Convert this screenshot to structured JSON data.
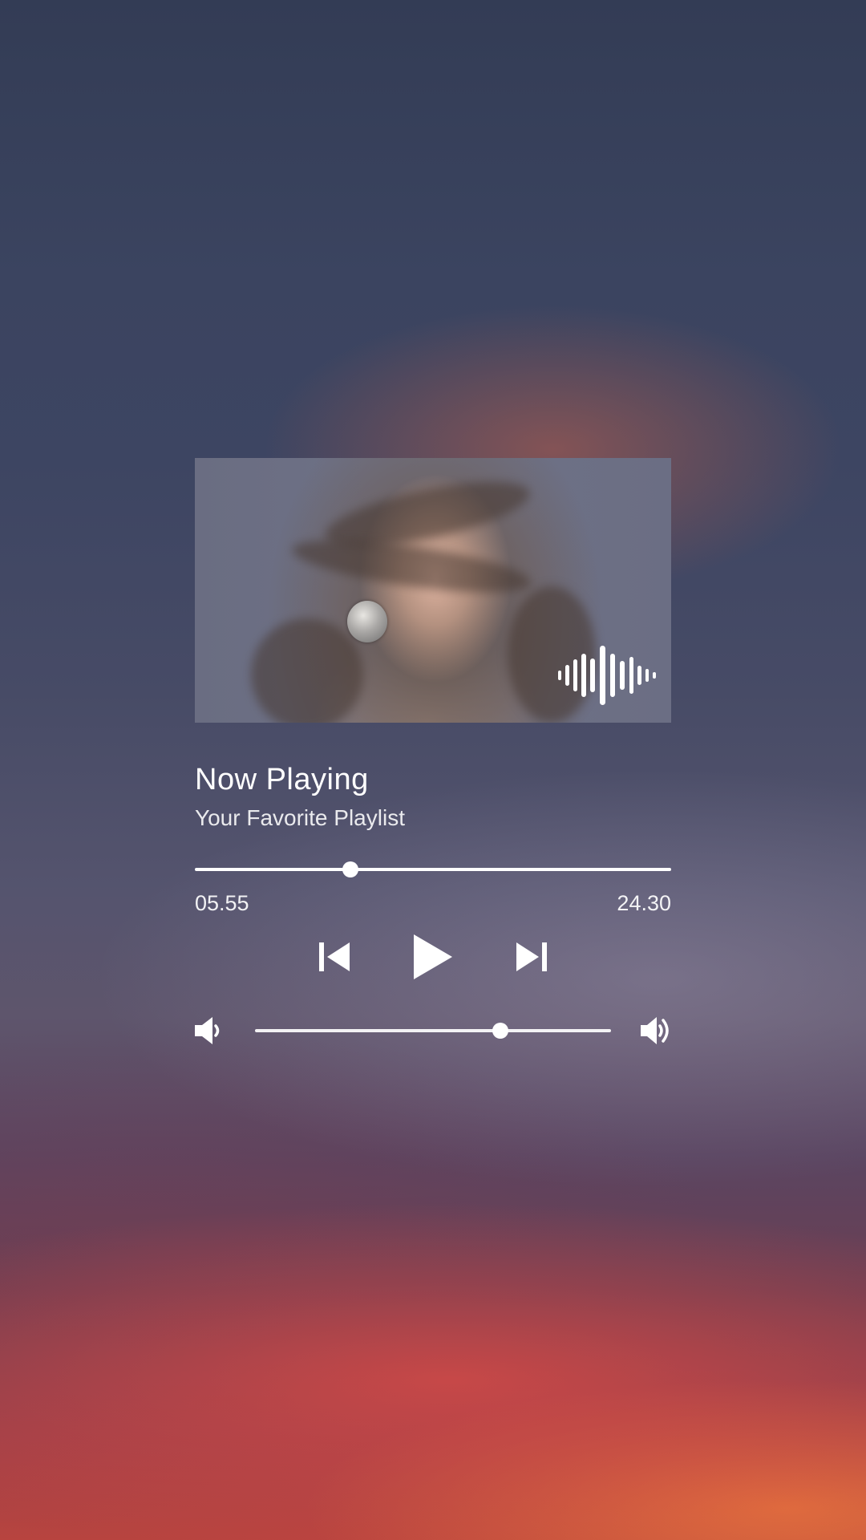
{
  "player": {
    "album_art": {
      "alt": "album cover",
      "icon": "soundwave-icon"
    },
    "title": "Now Playing",
    "subtitle": "Your Favorite Playlist",
    "progress": {
      "fraction": 0.326,
      "elapsed": "05.55",
      "duration": "24.30"
    },
    "controls": {
      "previous_icon": "skip-previous-icon",
      "play_icon": "play-icon",
      "next_icon": "skip-next-icon"
    },
    "volume": {
      "fraction": 0.69,
      "low_icon": "volume-low-icon",
      "high_icon": "volume-high-icon"
    }
  },
  "colors": {
    "foreground": "#ffffff",
    "sky_top": "#333c55",
    "sky_bottom": "#b8443f"
  }
}
